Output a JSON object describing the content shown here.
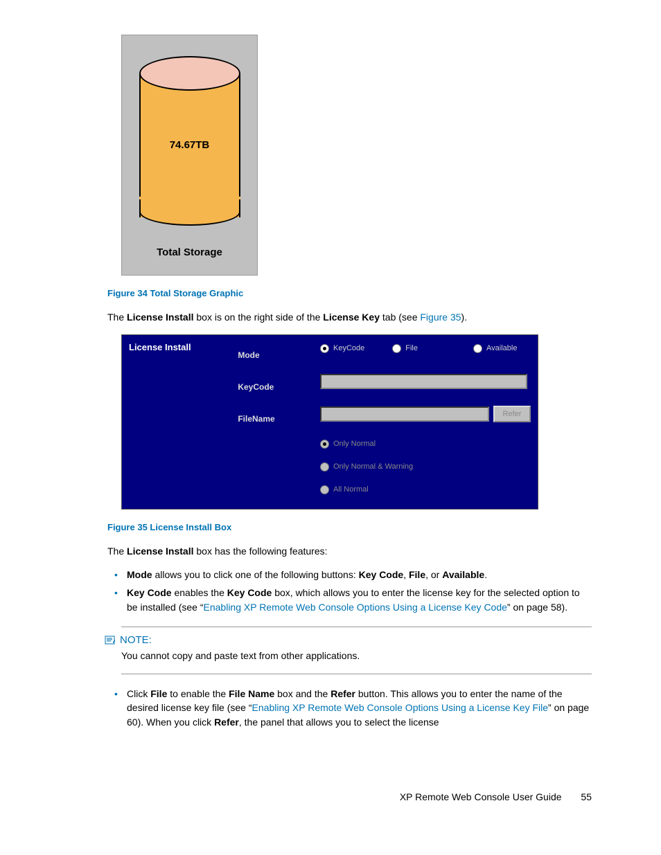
{
  "storage": {
    "value": "74.67TB",
    "caption": "Total Storage"
  },
  "figure34": "Figure 34 Total Storage Graphic",
  "para1": {
    "t1": "The ",
    "b1": "License Install",
    "t2": " box is on the right side of the ",
    "b2": "License Key",
    "t3": " tab (see ",
    "link": "Figure 35",
    "t4": ")."
  },
  "panel": {
    "title": "License Install",
    "modeLabel": "Mode",
    "keycodeLabel": "KeyCode",
    "filenameLabel": "FileName",
    "radios": {
      "keycode": "KeyCode",
      "file": "File",
      "available": "Available"
    },
    "referBtn": "Refer",
    "opts": {
      "onlyNormal": "Only Normal",
      "onlyNormalWarn": "Only Normal & Warning",
      "allNormal": "All Normal"
    }
  },
  "figure35": "Figure 35 License Install Box",
  "para2": {
    "t1": "The ",
    "b1": "License Install",
    "t2": " box has the following features:"
  },
  "bullets": {
    "b1": {
      "bold1": "Mode",
      "t1": " allows you to click one of the following buttons: ",
      "bold2": "Key Code",
      "t2": ", ",
      "bold3": "File",
      "t3": ", or ",
      "bold4": "Available",
      "t4": "."
    },
    "b2": {
      "bold1": "Key Code",
      "t1": " enables the ",
      "bold2": "Key Code",
      "t2": " box, which allows you to enter the license key for the selected option to be installed (see “",
      "link": "Enabling XP Remote Web Console Options Using a License Key Code",
      "t3": "” on page 58)."
    },
    "b3": {
      "t1": "Click ",
      "bold1": "File",
      "t2": " to enable the ",
      "bold2": "File Name",
      "t3": " box and the ",
      "bold3": "Refer",
      "t4": " button. This allows you to enter the name of the desired license key file (see “",
      "link": "Enabling XP Remote Web Console Options Using a License Key File",
      "t5": "” on page 60). When you click ",
      "bold4": "Refer",
      "t6": ", the panel that allows you to select the license"
    }
  },
  "note": {
    "header": "NOTE:",
    "body": "You cannot copy and paste text from other applications."
  },
  "footer": {
    "title": "XP Remote Web Console User Guide",
    "page": "55"
  }
}
